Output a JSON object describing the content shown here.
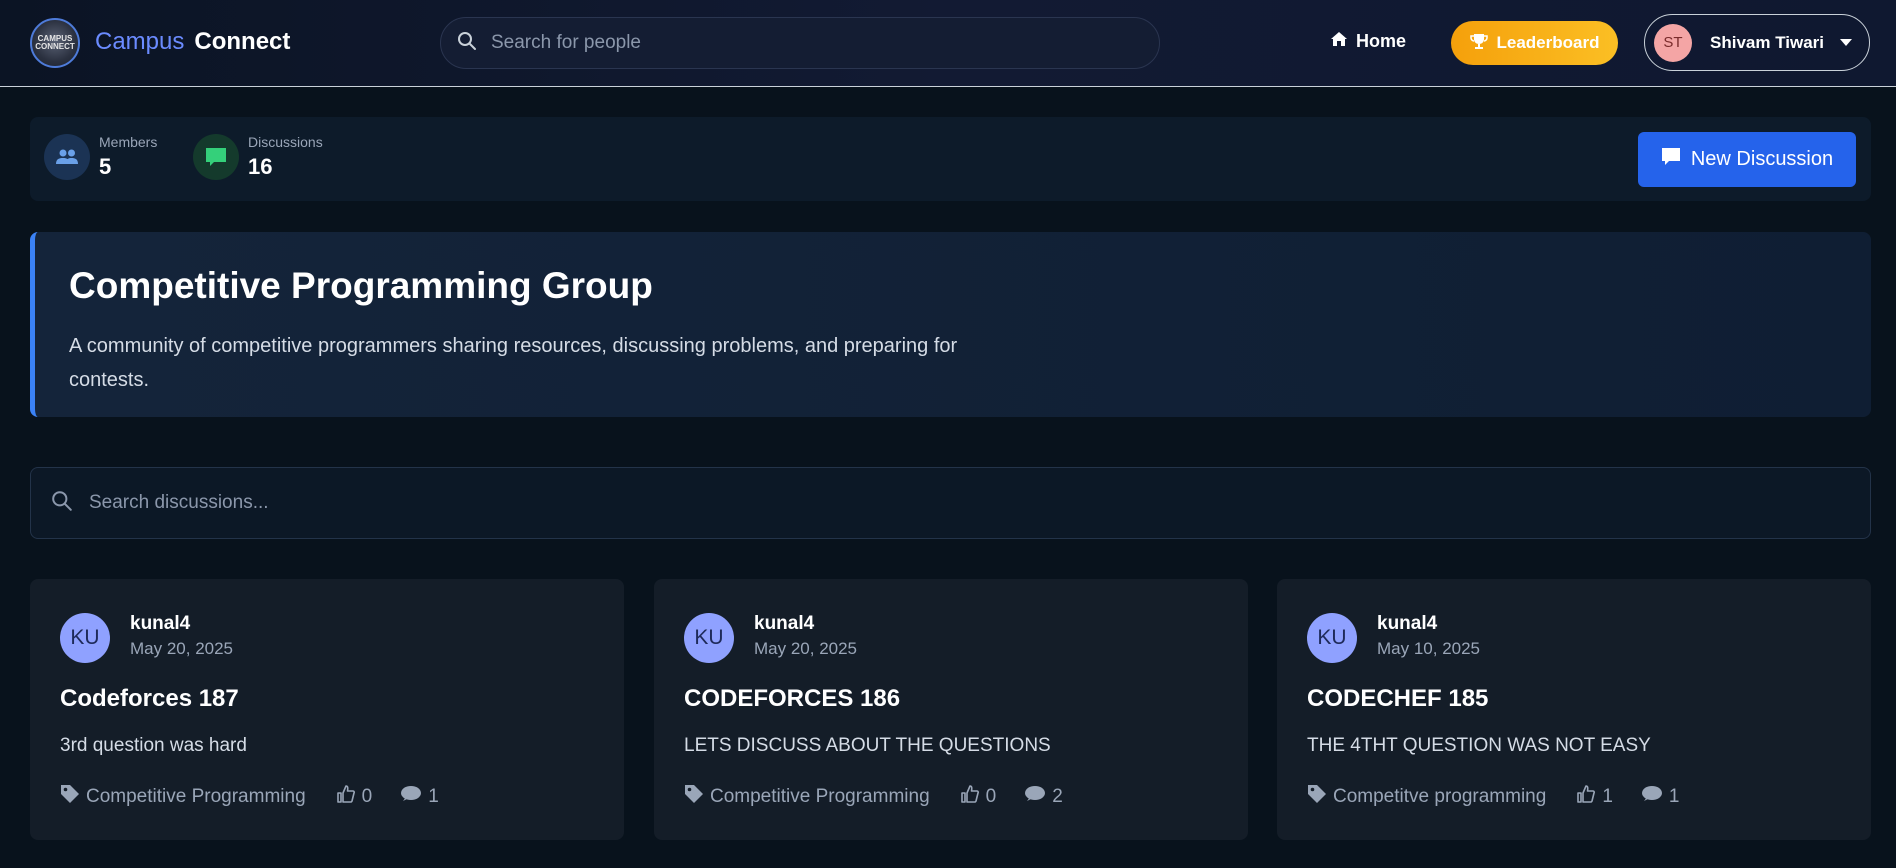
{
  "navbar": {
    "logo_text": "CAMPUS CONNECT",
    "brand_part1": "Campus",
    "brand_part2": "Connect",
    "people_search_placeholder": "Search for people",
    "home_label": "Home",
    "leaderboard_label": "Leaderboard",
    "user": {
      "initials": "ST",
      "name": "Shivam Tiwari"
    }
  },
  "stats": {
    "members": {
      "label": "Members",
      "value": "5"
    },
    "discussions": {
      "label": "Discussions",
      "value": "16"
    }
  },
  "new_discussion_label": "New Discussion",
  "group": {
    "title": "Competitive Programming Group",
    "description": "A community of competitive programmers sharing resources, discussing problems, and preparing for contests."
  },
  "discussion_search_placeholder": "Search discussions...",
  "discussions": [
    {
      "initials": "KU",
      "author": "kunal4",
      "date": "May 20, 2025",
      "title": "Codeforces 187",
      "body": "3rd question was hard",
      "tag": "Competitive Programming",
      "likes": "0",
      "comments": "1"
    },
    {
      "initials": "KU",
      "author": "kunal4",
      "date": "May 20, 2025",
      "title": "CODEFORCES 186",
      "body": "LETS DISCUSS ABOUT THE QUESTIONS",
      "tag": "Competitive Programming",
      "likes": "0",
      "comments": "2"
    },
    {
      "initials": "KU",
      "author": "kunal4",
      "date": "May 10, 2025",
      "title": "CODECHEF 185",
      "body": "THE 4THT QUESTION WAS NOT EASY",
      "tag": "Competitve programming",
      "likes": "1",
      "comments": "1"
    }
  ],
  "colors": {
    "accent": "#2563eb",
    "leaderboard": "#fbbf24",
    "avatar": "#8fa1ff",
    "banner_border": "#3b82f6"
  }
}
